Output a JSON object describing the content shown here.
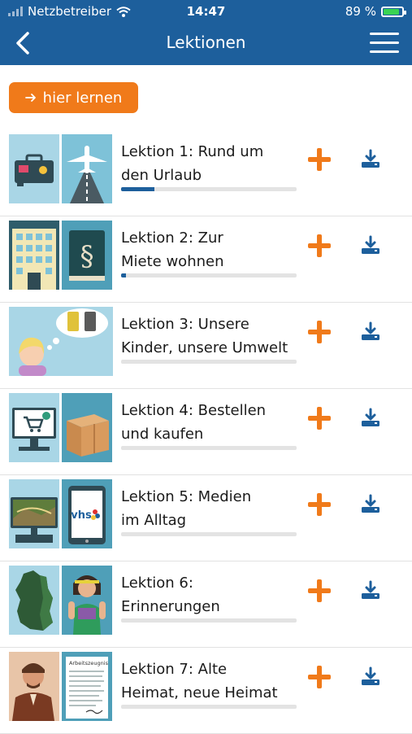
{
  "status": {
    "carrier": "Netzbetreiber",
    "time": "14:47",
    "battery": "89 %"
  },
  "nav": {
    "title": "Lektionen"
  },
  "learn_button": "hier lernen",
  "lessons": [
    {
      "line1": "Lektion 1: Rund um",
      "line2": "den Urlaub",
      "progress": 0.19
    },
    {
      "line1": "Lektion 2: Zur",
      "line2": "Miete wohnen",
      "progress": 0.03
    },
    {
      "line1": "Lektion 3: Unsere",
      "line2": "Kinder, unsere Umwelt",
      "progress": 0
    },
    {
      "line1": "Lektion 4: Bestellen",
      "line2": "und kaufen",
      "progress": 0
    },
    {
      "line1": "Lektion 5: Medien",
      "line2": "im Alltag",
      "progress": 0
    },
    {
      "line1": "Lektion 6:",
      "line2": "Erinnerungen",
      "progress": 0
    },
    {
      "line1": "Lektion 7: Alte",
      "line2": "Heimat, neue Heimat",
      "progress": 0
    }
  ],
  "thumb_text": {
    "vhs": "vhs",
    "arbeitszeugnis": "Arbeitszeugnis"
  },
  "icons": [
    "signal-icon",
    "wifi-icon",
    "battery-icon",
    "back-arrow-icon",
    "hamburger-menu-icon",
    "arrow-right-icon",
    "plus-icon",
    "download-icon"
  ],
  "colors": {
    "header": "#1d5f9c",
    "accent": "#f07a1a",
    "progress": "#1d5f9c"
  }
}
